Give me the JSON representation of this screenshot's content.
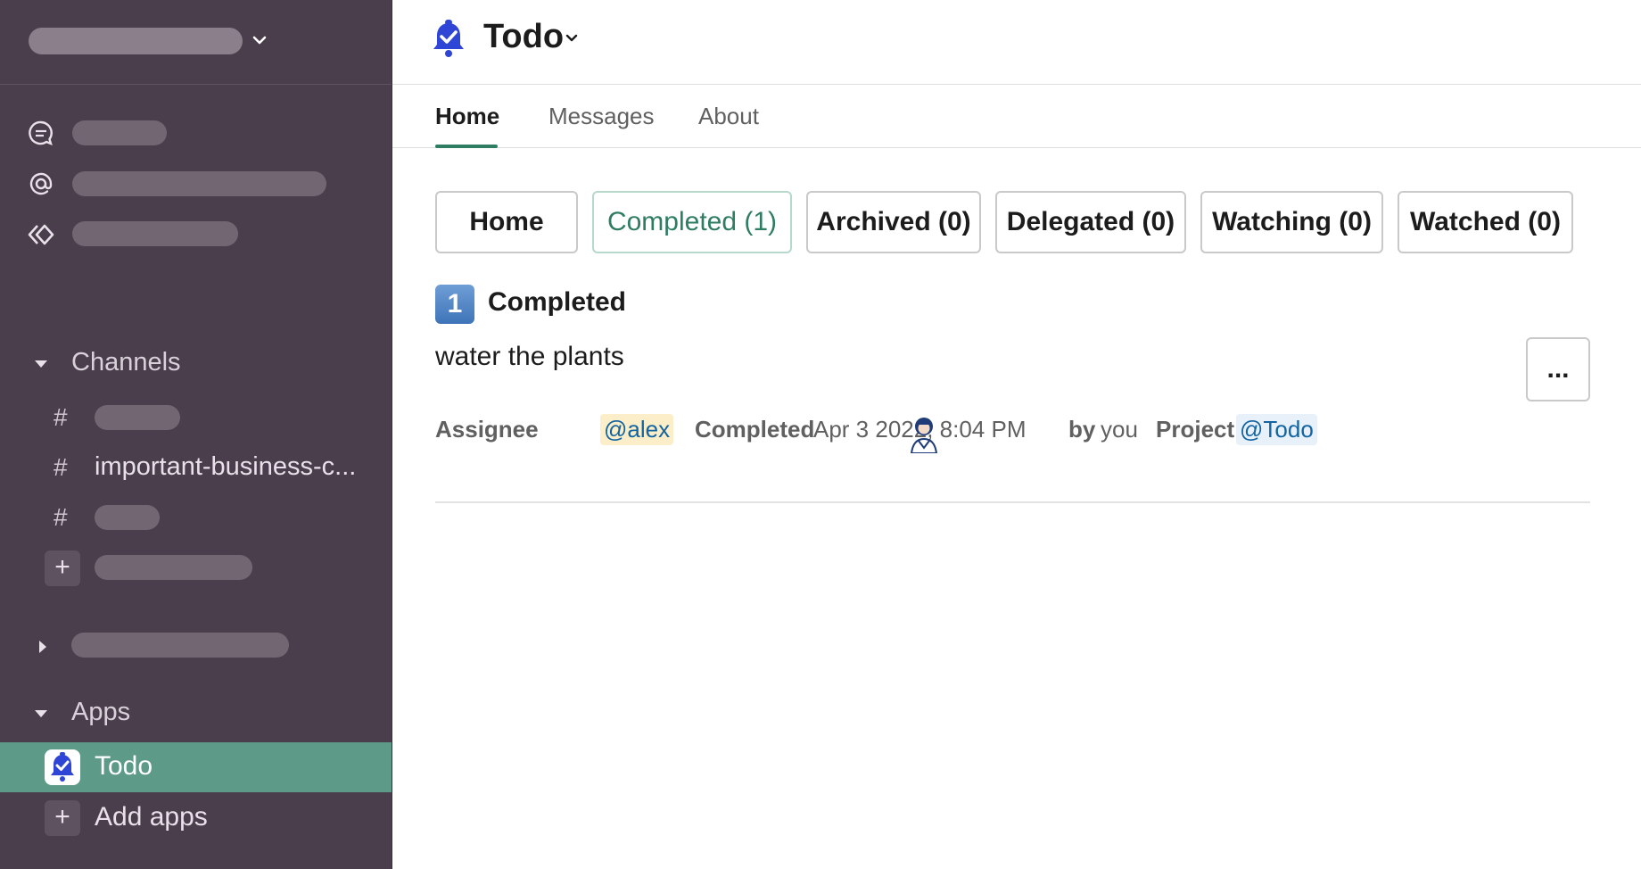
{
  "sidebar": {
    "sections": {
      "channels_label": "Channels",
      "apps_label": "Apps"
    },
    "channels": [
      {
        "label": ""
      },
      {
        "label": "important-business-c..."
      },
      {
        "label": ""
      }
    ],
    "hash_symbol": "#",
    "add_symbol": "+",
    "apps": {
      "active_label": "Todo",
      "add_label": "Add apps"
    }
  },
  "header": {
    "title": "Todo"
  },
  "tabs": [
    {
      "label": "Home"
    },
    {
      "label": "Messages"
    },
    {
      "label": "About"
    }
  ],
  "filters": [
    {
      "label": "Home"
    },
    {
      "label": "Completed (1)"
    },
    {
      "label": "Archived (0)"
    },
    {
      "label": "Delegated (0)"
    },
    {
      "label": "Watching (0)"
    },
    {
      "label": "Watched (0)"
    }
  ],
  "section": {
    "badge": "1",
    "title": "Completed"
  },
  "task": {
    "text": "water the plants",
    "more": "...",
    "assignee_label": "Assignee",
    "assignee": "@alex",
    "completed_label": "Completed",
    "completed_at": "Apr 3 2022, 8:04 PM",
    "by_label": "by",
    "by_value": "you",
    "project_label": "Project",
    "project": "@Todo"
  },
  "colors": {
    "sidebar_bg": "#4a3d4c",
    "active_app_bg": "#5d9a87",
    "accent": "#2e7d62",
    "link": "#1264a3"
  }
}
